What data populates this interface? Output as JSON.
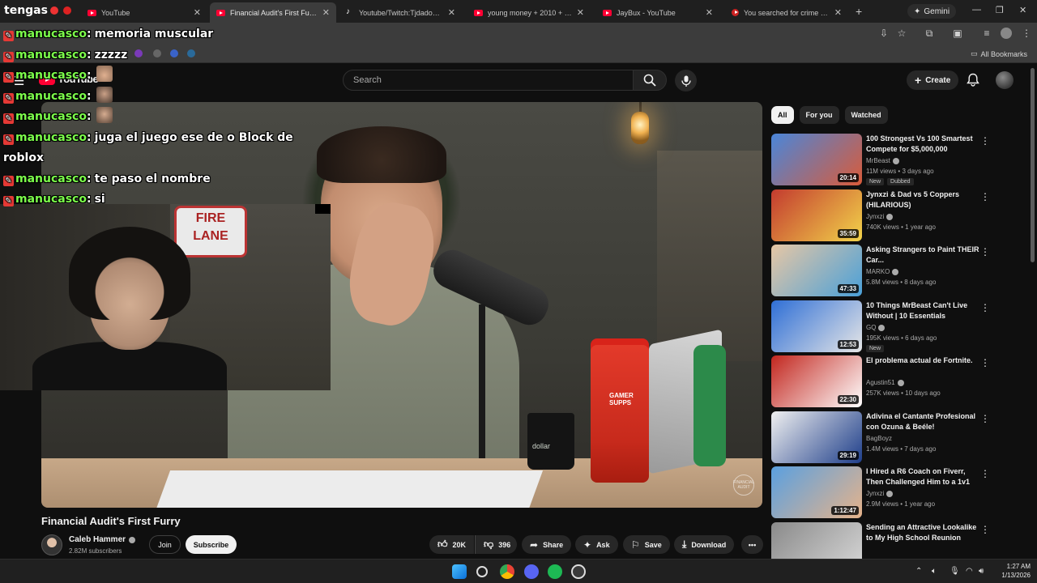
{
  "browser": {
    "tabs": [
      {
        "title": "YouTube",
        "icon": "youtube-icon",
        "active": false
      },
      {
        "title": "Financial Audit's First Furry - YouTube",
        "icon": "youtube-icon",
        "active": true
      },
      {
        "title": "Youtube/Twitch:Tjdadonlivett l…",
        "icon": "tiktok-icon",
        "active": false
      },
      {
        "title": "young money + 2010 + drake",
        "icon": "youtube-icon",
        "active": false
      },
      {
        "title": "JayBux - YouTube",
        "icon": "youtube-icon",
        "active": false
      },
      {
        "title": "You searched for crime detecti…",
        "icon": "bookmark-red-icon",
        "active": false
      }
    ],
    "gemini_label": "Gemini",
    "all_bookmarks_label": "All Bookmarks",
    "stream_brand": "tengas"
  },
  "chat": [
    {
      "user": "manucasco",
      "message": "memoria muscular",
      "emotes": []
    },
    {
      "user": "manucasco",
      "message": "zzzzz",
      "emotes": []
    },
    {
      "user": "manucasco",
      "message": "",
      "emotes": [
        "hand-emote"
      ]
    },
    {
      "user": "manucasco",
      "message": "",
      "emotes": [
        "face-emote"
      ]
    },
    {
      "user": "manucasco",
      "message": "",
      "emotes": [
        "face-emote-2"
      ]
    },
    {
      "user": "manucasco",
      "message": "juga el juego ese de o Block de roblox",
      "emotes": []
    },
    {
      "user": "manucasco",
      "message": "te paso el nombre",
      "emotes": []
    },
    {
      "user": "manucasco",
      "message": "si",
      "emotes": []
    }
  ],
  "header": {
    "logo_text": "YouTube",
    "search_placeholder": "Search",
    "create_label": "Create"
  },
  "video": {
    "title": "Financial Audit's First Furry",
    "sign_text": "FIRE LANE",
    "shaker_text": "GAMER SUPPS",
    "mug_text": "dollar",
    "watermark": "FINANCIAL AUDIT",
    "channel": {
      "name": "Caleb Hammer",
      "subscribers": "2.82M subscribers"
    },
    "join_label": "Join",
    "subscribe_label": "Subscribe",
    "likes": "20K",
    "dislikes": "396",
    "share_label": "Share",
    "ask_label": "Ask",
    "save_label": "Save",
    "download_label": "Download"
  },
  "chips": [
    "All",
    "For you",
    "Watched"
  ],
  "recommendations": [
    {
      "title": "100 Strongest Vs 100 Smartest Compete for $5,000,000",
      "channel": "MrBeast",
      "verified": true,
      "meta": "11M views • 3 days ago",
      "duration": "20:14",
      "badges": [
        "New",
        "Dubbed"
      ],
      "thumb_colors": [
        "#4a86d9",
        "#d95b3a"
      ]
    },
    {
      "title": "Jynxzi & Dad vs 5 Coppers (HILARIOUS)",
      "channel": "Jynxzi",
      "verified": true,
      "meta": "740K views • 1 year ago",
      "duration": "35:59",
      "badges": [],
      "thumb_colors": [
        "#c33b2f",
        "#f2d34a"
      ]
    },
    {
      "title": "Asking Strangers to Paint THEIR Car...",
      "channel": "MARKO",
      "verified": true,
      "meta": "5.8M views • 8 days ago",
      "duration": "47:33",
      "badges": [],
      "thumb_colors": [
        "#e7c7a5",
        "#4aa0d8"
      ]
    },
    {
      "title": "10 Things MrBeast Can't Live Without | 10 Essentials",
      "channel": "GQ",
      "verified": true,
      "meta": "195K views • 6 days ago",
      "duration": "12:53",
      "badges": [
        "New"
      ],
      "thumb_colors": [
        "#2f6fd6",
        "#e6e6e6"
      ]
    },
    {
      "title": "El problema actual de Fortnite.",
      "channel": "Agustin51",
      "verified": true,
      "meta": "257K views • 10 days ago",
      "duration": "22:30",
      "badges": [],
      "thumb_colors": [
        "#c2261e",
        "#ffffff"
      ]
    },
    {
      "title": "Adivina el Cantante Profesional con Ozuna & Beéle!",
      "channel": "BagBoyz",
      "verified": false,
      "meta": "1.4M views • 7 days ago",
      "duration": "29:19",
      "badges": [],
      "thumb_colors": [
        "#f0f0f0",
        "#1e3e8a"
      ]
    },
    {
      "title": "I Hired a R6 Coach on Fiverr, Then Challenged Him to a 1v1",
      "channel": "Jynxzi",
      "verified": true,
      "meta": "2.9M views • 1 year ago",
      "duration": "1:12:47",
      "badges": [],
      "thumb_colors": [
        "#5aa0e0",
        "#e6b38a"
      ]
    },
    {
      "title": "Sending an Attractive Lookalike to My High School Reunion",
      "channel": "",
      "verified": false,
      "meta": "",
      "duration": "",
      "badges": [],
      "thumb_colors": [
        "#8a8a8a",
        "#d8d8d8"
      ]
    }
  ],
  "taskbar": {
    "time": "1:27 AM",
    "date": "1/13/2026"
  }
}
